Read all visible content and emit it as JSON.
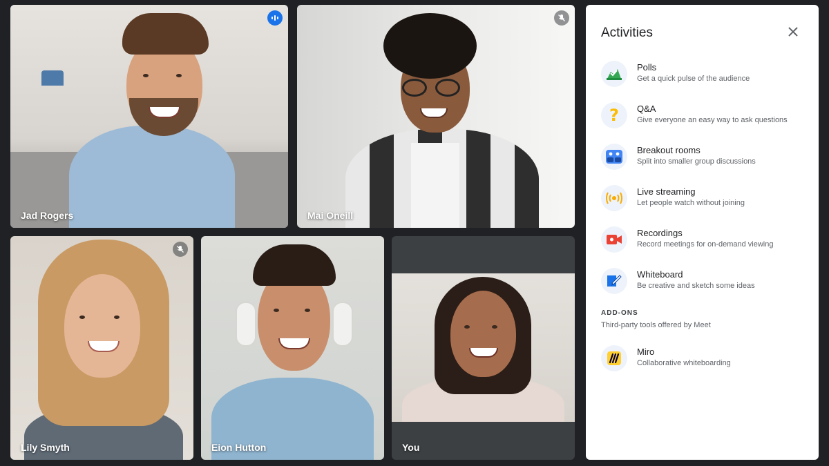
{
  "participants": [
    {
      "name": "Jad Rogers",
      "status": "speaking"
    },
    {
      "name": "Mai Oneill",
      "status": "muted"
    },
    {
      "name": "Lily Smyth",
      "status": "muted"
    },
    {
      "name": "Eion Hutton",
      "status": "none"
    },
    {
      "name": "You",
      "status": "none"
    }
  ],
  "panel": {
    "title": "Activities",
    "activities": [
      {
        "label": "Polls",
        "desc": "Get a quick pulse of the audience",
        "icon": "polls-icon"
      },
      {
        "label": "Q&A",
        "desc": "Give everyone an easy way to ask questions",
        "icon": "question-icon"
      },
      {
        "label": "Breakout rooms",
        "desc": "Split into smaller group discussions",
        "icon": "breakout-rooms-icon"
      },
      {
        "label": "Live streaming",
        "desc": "Let people watch without joining",
        "icon": "live-streaming-icon"
      },
      {
        "label": "Recordings",
        "desc": "Record meetings for on-demand viewing",
        "icon": "recording-icon"
      },
      {
        "label": "Whiteboard",
        "desc": "Be creative and sketch some ideas",
        "icon": "whiteboard-icon"
      }
    ],
    "addons_heading": "ADD-ONS",
    "addons_sub": "Third-party tools offered by Meet",
    "addons": [
      {
        "label": "Miro",
        "desc": "Collaborative whiteboarding",
        "icon": "miro-icon"
      }
    ]
  },
  "colors": {
    "background": "#202124",
    "active_outline": "#8ab4f8",
    "speaking_badge": "#1a73e8"
  }
}
